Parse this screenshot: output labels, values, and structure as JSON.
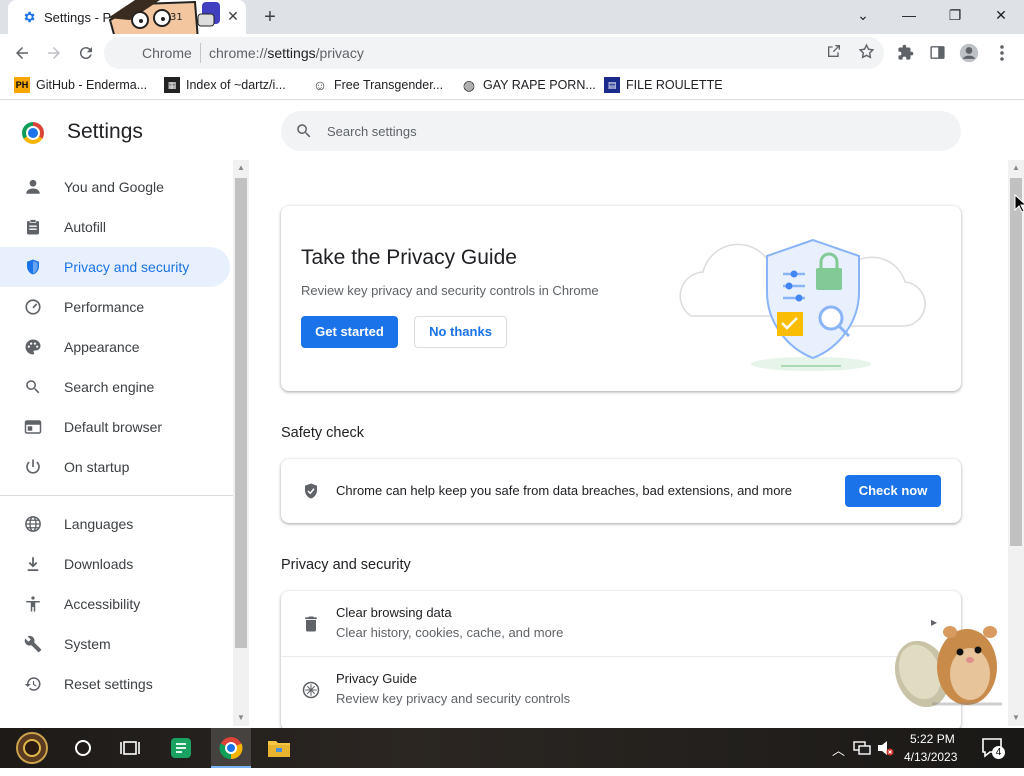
{
  "browser": {
    "tab": {
      "title": "Settings - Pr",
      "close": "✕"
    },
    "new_tab": "+",
    "window_controls": {
      "minimize": "—",
      "restore": "❐",
      "close": "✕",
      "dropdown": "⌄"
    },
    "omnibox": {
      "site_label": "Chrome",
      "url_host": "chrome://",
      "url_path": "settings",
      "url_rest": "/privacy"
    }
  },
  "bookmarks": [
    {
      "label": "GitHub - Enderma...",
      "icon": "PH",
      "icon_bg": "#f7a600",
      "icon_fg": "#000000"
    },
    {
      "label": "Index of ~dartz/i...",
      "icon": "▦",
      "icon_bg": "#222222",
      "icon_fg": "#ffffff"
    },
    {
      "label": "Free Transgender...",
      "icon": "☺",
      "icon_bg": "#ffffff",
      "icon_fg": "#333333"
    },
    {
      "label": "GAY RAPE PORN...",
      "icon": "◍",
      "icon_bg": "#ffffff",
      "icon_fg": "#333333"
    },
    {
      "label": "FILE ROULETTE",
      "icon": "▤",
      "icon_bg": "#1a2b8c",
      "icon_fg": "#ffffff"
    }
  ],
  "settings": {
    "title": "Settings",
    "search_placeholder": "Search settings"
  },
  "sidebar": {
    "items": [
      {
        "label": "You and Google",
        "icon": "person-icon"
      },
      {
        "label": "Autofill",
        "icon": "clipboard-icon"
      },
      {
        "label": "Privacy and security",
        "icon": "shield-icon",
        "active": true
      },
      {
        "label": "Performance",
        "icon": "gauge-icon"
      },
      {
        "label": "Appearance",
        "icon": "palette-icon"
      },
      {
        "label": "Search engine",
        "icon": "search-icon"
      },
      {
        "label": "Default browser",
        "icon": "browser-icon"
      },
      {
        "label": "On startup",
        "icon": "power-icon"
      },
      {
        "label": "Languages",
        "icon": "globe-icon"
      },
      {
        "label": "Downloads",
        "icon": "download-icon"
      },
      {
        "label": "Accessibility",
        "icon": "accessibility-icon"
      },
      {
        "label": "System",
        "icon": "wrench-icon"
      },
      {
        "label": "Reset settings",
        "icon": "reset-icon"
      }
    ]
  },
  "privacy_guide": {
    "title": "Take the Privacy Guide",
    "description": "Review key privacy and security controls in Chrome",
    "primary_button": "Get started",
    "secondary_button": "No thanks"
  },
  "safety_check": {
    "heading": "Safety check",
    "text": "Chrome can help keep you safe from data breaches, bad extensions, and more",
    "button": "Check now"
  },
  "privacy_section": {
    "heading": "Privacy and security",
    "rows": [
      {
        "title": "Clear browsing data",
        "subtitle": "Clear history, cookies, cache, and more",
        "icon": "trash-icon"
      },
      {
        "title": "Privacy Guide",
        "subtitle": "Review key privacy and security controls",
        "icon": "compass-icon"
      }
    ]
  },
  "taskbar": {
    "time": "5:22 PM",
    "date": "4/13/2023",
    "notification_count": "4"
  },
  "colors": {
    "accent": "#1a73e8",
    "active_nav_bg": "#e8f0fe",
    "tabstrip_bg": "#dee1e6"
  }
}
